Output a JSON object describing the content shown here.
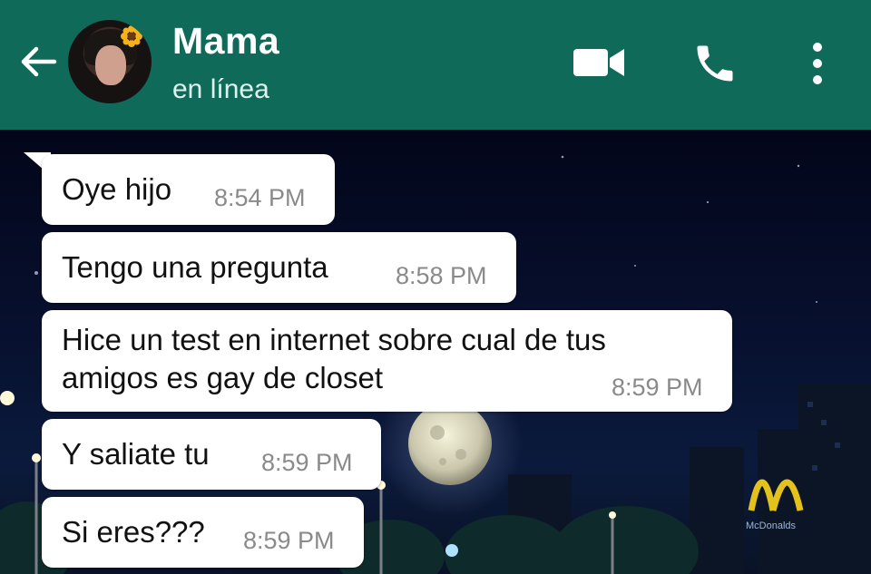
{
  "header": {
    "contact_name": "Mama",
    "status": "en línea",
    "icons": {
      "back": "arrow-back-icon",
      "video": "video-call-icon",
      "phone": "phone-call-icon",
      "menu": "more-vertical-icon"
    },
    "background_color": "#0f6a5a"
  },
  "chat": {
    "messages": [
      {
        "text": "Oye hijo",
        "time": "8:54 PM"
      },
      {
        "text": "Tengo una pregunta",
        "time": "8:58 PM"
      },
      {
        "text": "Hice un test en internet sobre cual de tus\namigos es gay de closet",
        "time": "8:59 PM"
      },
      {
        "text": "Y saliate tu",
        "time": "8:59 PM"
      },
      {
        "text": "Si eres???",
        "time": "8:59 PM"
      }
    ],
    "wallpaper": {
      "sign_text": "McDonalds"
    }
  }
}
